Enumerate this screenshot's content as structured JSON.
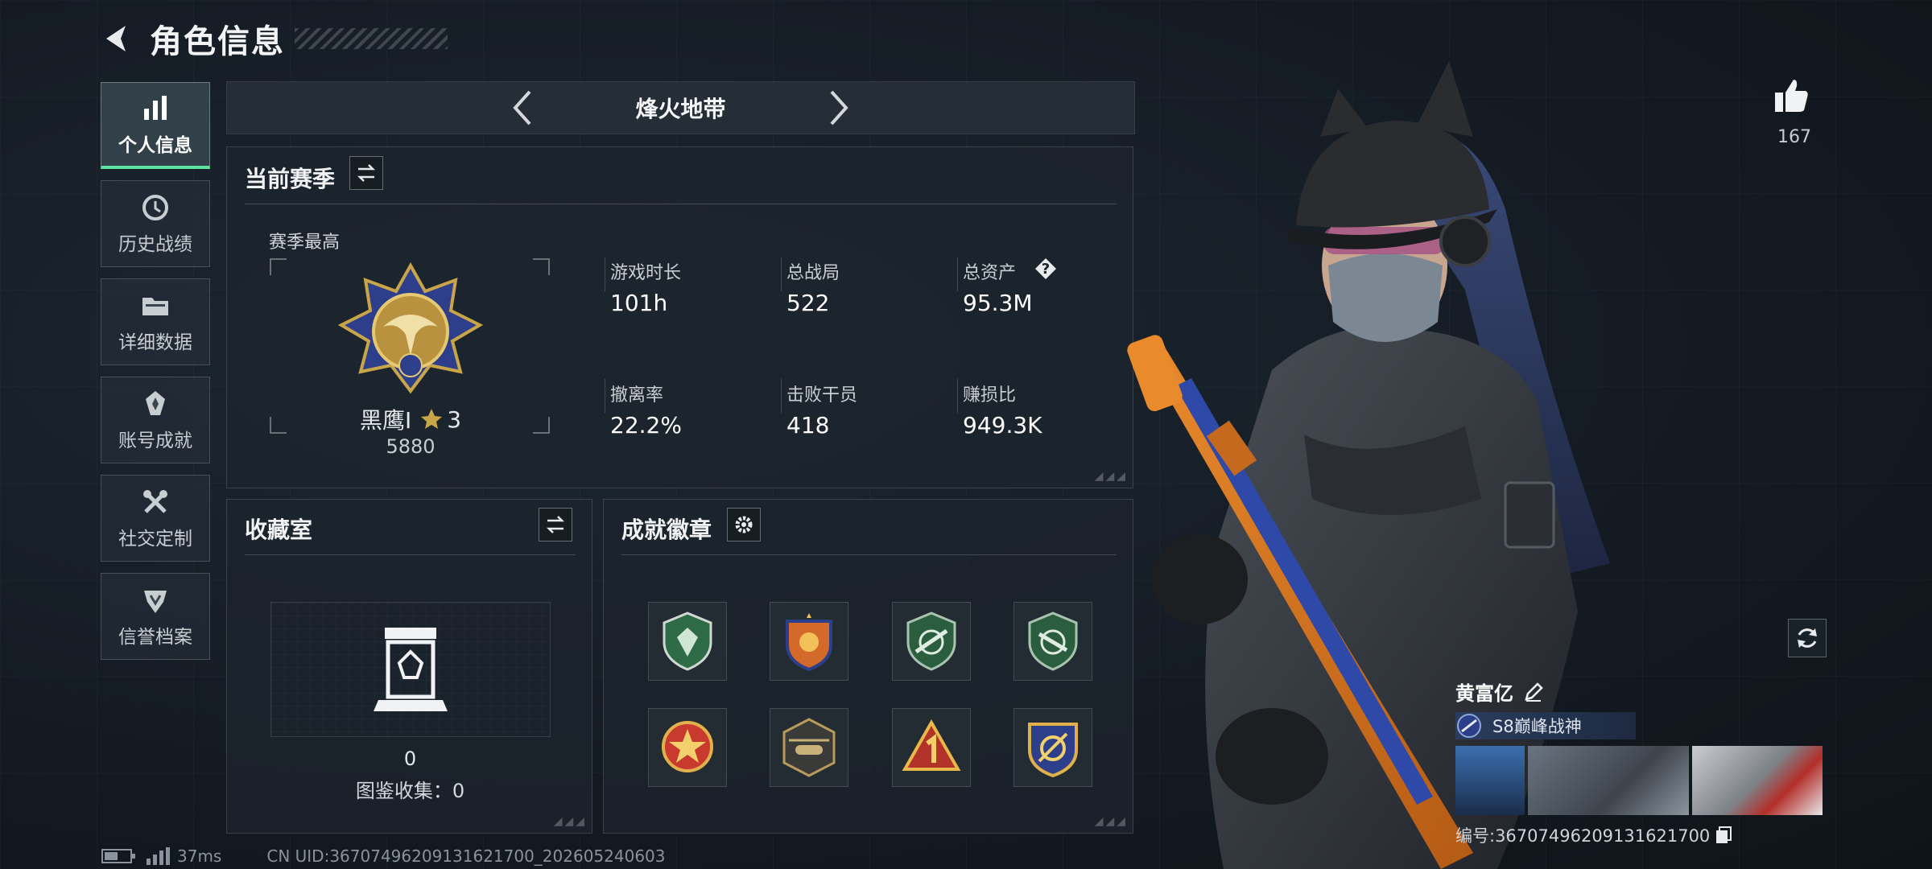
{
  "header": {
    "title": "角色信息"
  },
  "sidebar": {
    "items": [
      {
        "label": "个人信息",
        "icon": "bar-chart-icon",
        "active": true
      },
      {
        "label": "历史战绩",
        "icon": "history-icon"
      },
      {
        "label": "详细数据",
        "icon": "folder-icon"
      },
      {
        "label": "账号成就",
        "icon": "achievement-icon"
      },
      {
        "label": "社交定制",
        "icon": "tools-icon"
      },
      {
        "label": "信誉档案",
        "icon": "credit-icon"
      }
    ]
  },
  "mode": {
    "title": "烽火地带"
  },
  "season": {
    "title": "当前赛季",
    "best_label": "赛季最高",
    "rank_name": "黑鹰I",
    "rank_stars": "3",
    "rank_score": "5880",
    "stats": [
      {
        "label": "游戏时长",
        "value": "101h"
      },
      {
        "label": "总战局",
        "value": "522"
      },
      {
        "label": "总资产",
        "value": "95.3M",
        "help": "?"
      },
      {
        "label": "撤离率",
        "value": "22.2%"
      },
      {
        "label": "击败干员",
        "value": "418"
      },
      {
        "label": "赚损比",
        "value": "949.3K"
      }
    ]
  },
  "collection": {
    "title": "收藏室",
    "count": "0",
    "summary": "图鉴收集：0"
  },
  "achievements": {
    "title": "成就徽章"
  },
  "footer": {
    "ping": "37ms",
    "uid": "CN UID:3670749620913162170​0_202605240603"
  },
  "right": {
    "like_count": "167",
    "player_name": "黄富亿",
    "player_title": "S8巅峰战神",
    "player_id": "编号:3670749620913162170​0"
  },
  "colors": {
    "accent": "#5fe3a0",
    "gold": "#c9a54a"
  }
}
